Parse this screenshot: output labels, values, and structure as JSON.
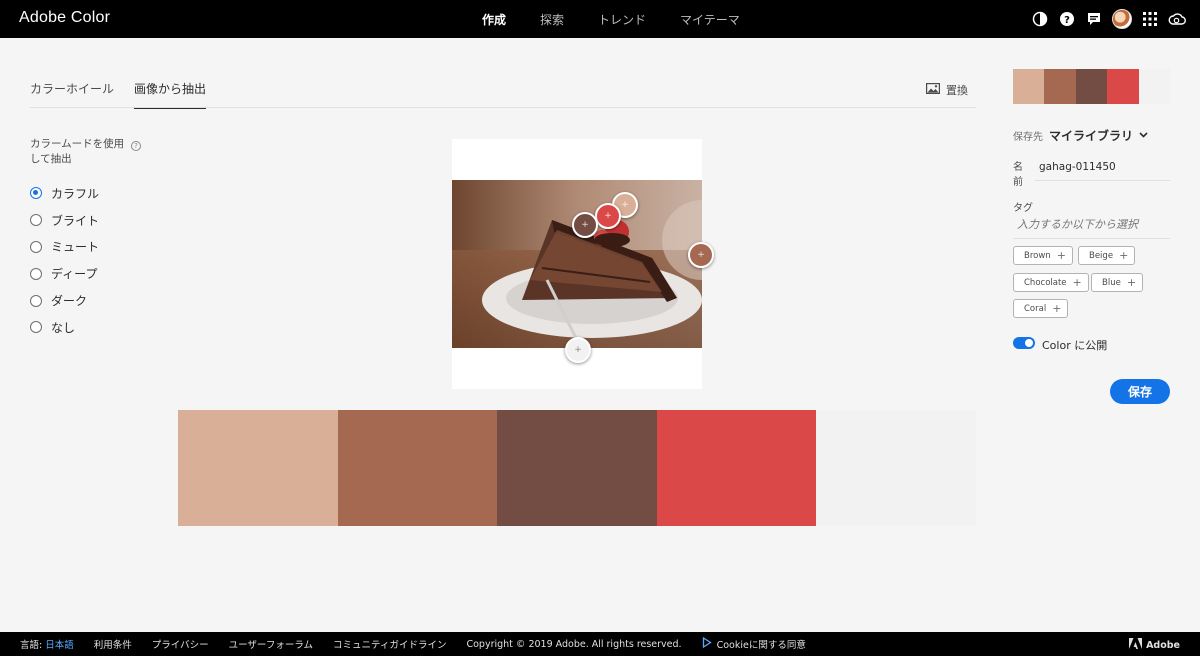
{
  "app": {
    "title": "Adobe Color"
  },
  "nav": [
    {
      "label": "作成",
      "active": true
    },
    {
      "label": "探索",
      "active": false
    },
    {
      "label": "トレンド",
      "active": false
    },
    {
      "label": "マイテーマ",
      "active": false
    }
  ],
  "tabs": [
    {
      "label": "カラーホイール",
      "active": false
    },
    {
      "label": "画像から抽出",
      "active": true
    }
  ],
  "replace_label": "置換",
  "mode": {
    "label": "カラームードを使用して抽出",
    "help": "?",
    "options": [
      {
        "label": "カラフル",
        "selected": true
      },
      {
        "label": "ブライト",
        "selected": false
      },
      {
        "label": "ミュート",
        "selected": false
      },
      {
        "label": "ディープ",
        "selected": false
      },
      {
        "label": "ダーク",
        "selected": false
      },
      {
        "label": "なし",
        "selected": false
      }
    ]
  },
  "palette": [
    "#d9af97",
    "#a56850",
    "#734c43",
    "#db4848",
    "#f2f2f2"
  ],
  "panel": {
    "save_to_label": "保存先",
    "library": "マイライブラリ",
    "name_label": "名前",
    "name_value": "gahag-011450",
    "tag_label": "タグ",
    "tag_placeholder": "入力するか以下から選択",
    "tags": [
      "Brown",
      "Beige",
      "Chocolate",
      "Blue",
      "Coral"
    ],
    "publish_label": "Color に公開",
    "publish_on": true,
    "save_label": "保存"
  },
  "footer": {
    "lang_label": "言語:",
    "lang_value": "日本語",
    "links": [
      "利用条件",
      "プライバシー",
      "ユーザーフォーラム",
      "コミュニティガイドライン"
    ],
    "copyright": "Copyright © 2019 Adobe. All rights reserved.",
    "cookie": "Cookieに関する同意",
    "adobe": "Adobe"
  },
  "icons": {
    "colorblind": "half-circle-icon",
    "help": "help-icon",
    "chat": "chat-icon",
    "apps": "app-grid-icon",
    "cc": "creative-cloud-icon",
    "image": "image-icon",
    "chevron": "chevron-down-icon"
  }
}
